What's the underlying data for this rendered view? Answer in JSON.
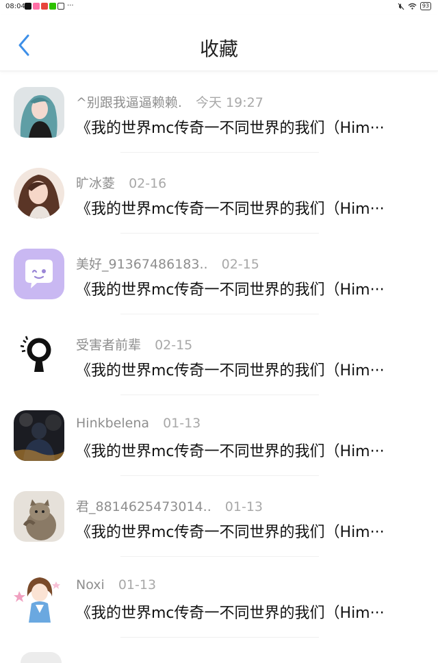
{
  "status_bar": {
    "time": "08:04",
    "app_icons": [
      "tiktok-icon",
      "app-icon-pink",
      "app-icon-red",
      "wechat-icon",
      "qq-icon"
    ],
    "app_colors": [
      "#111111",
      "#ff6fa6",
      "#e8453c",
      "#2dc100",
      "#1e1e1e"
    ],
    "more_dots": "···",
    "battery": "93"
  },
  "header": {
    "title": "收藏",
    "back_icon": "chevron-left-icon",
    "accent_color": "#3d8fe8"
  },
  "favorites": [
    {
      "user": "^别跟我逼逼赖赖.",
      "time": "今天 19:27",
      "title": "《我的世界mc传奇一不同世界的我们（Him···",
      "avatar": "avatar-teal-hair-girl"
    },
    {
      "user": "旷冰菱",
      "time": "02-16",
      "title": "《我的世界mc传奇一不同世界的我们（Him···",
      "avatar": "avatar-girl-brown-hair"
    },
    {
      "user": "美好_91367486183..",
      "time": "02-15",
      "title": "《我的世界mc传奇一不同世界的我们（Him···",
      "avatar": "avatar-purple-chat-bubble"
    },
    {
      "user": "受害者前辈",
      "time": "02-15",
      "title": "《我的世界mc传奇一不同世界的我们（Him···",
      "avatar": "avatar-black-keyhole"
    },
    {
      "user": "Hinkbelena",
      "time": "01-13",
      "title": "《我的世界mc传奇一不同世界的我们（Him···",
      "avatar": "avatar-dark-night-figure"
    },
    {
      "user": "君_8814625473014..",
      "time": "01-13",
      "title": "《我的世界mc传奇一不同世界的我们（Him···",
      "avatar": "avatar-kitten-photo"
    },
    {
      "user": "Noxi",
      "time": "01-13",
      "title": "《我的世界mc传奇一不同世界的我们（Him···",
      "avatar": "avatar-anime-girl"
    }
  ]
}
